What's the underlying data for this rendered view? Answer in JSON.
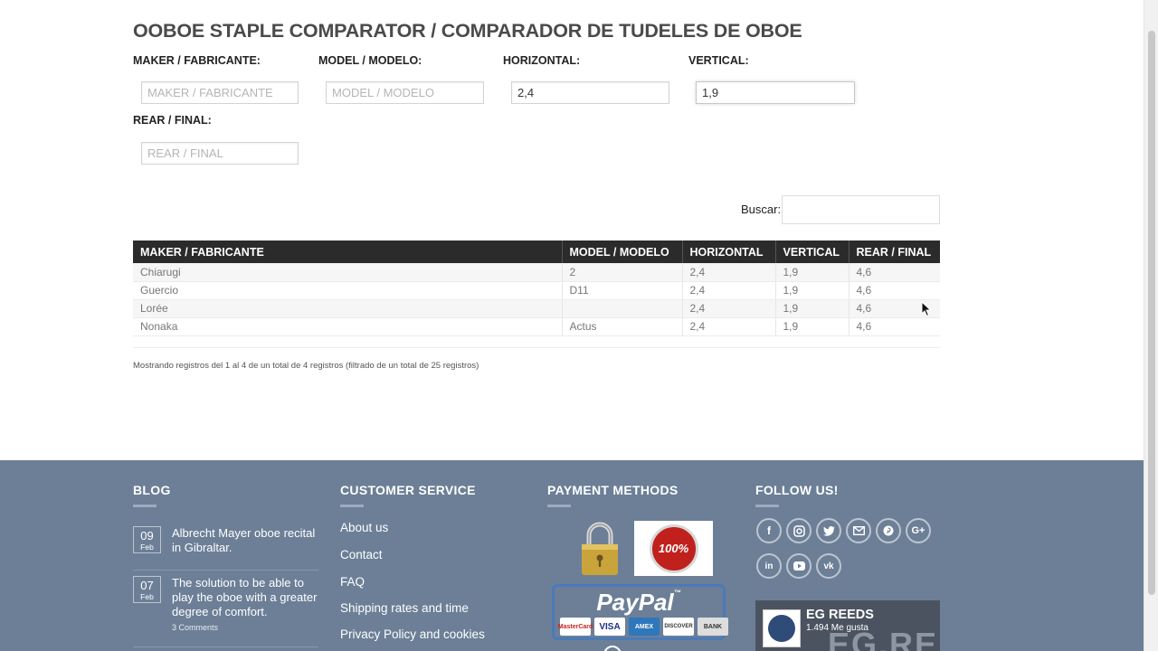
{
  "page_title": "OOBOE STAPLE COMPARATOR / COMPARADOR DE TUDELES DE OBOE",
  "filters": {
    "maker": {
      "label": "MAKER / FABRICANTE:",
      "placeholder": "MAKER / FABRICANTE",
      "value": ""
    },
    "model": {
      "label": "MODEL / MODELO:",
      "placeholder": "MODEL / MODELO",
      "value": ""
    },
    "horizontal": {
      "label": "HORIZONTAL:",
      "placeholder": "",
      "value": "2,4"
    },
    "vertical": {
      "label": "VERTICAL:",
      "placeholder": "",
      "value": "1,9"
    },
    "rear": {
      "label": "REAR / FINAL:",
      "placeholder": "REAR / FINAL",
      "value": ""
    }
  },
  "search": {
    "label": "Buscar:",
    "value": ""
  },
  "table": {
    "headers": [
      "MAKER / FABRICANTE",
      "MODEL / MODELO",
      "HORIZONTAL",
      "VERTICAL",
      "REAR / FINAL"
    ],
    "rows": [
      [
        "Chiarugi",
        "2",
        "2,4",
        "1,9",
        "4,6"
      ],
      [
        "Guercio",
        "D11",
        "2,4",
        "1,9",
        "4,6"
      ],
      [
        "Lorée",
        "",
        "2,4",
        "1,9",
        "4,6"
      ],
      [
        "Nonaka",
        "Actus",
        "2,4",
        "1,9",
        "4,6"
      ]
    ]
  },
  "info_text": "Mostrando registros del 1 al 4 de un total de 4 registros (filtrado de un total de 25 registros)",
  "footer": {
    "background": "#6c7f97",
    "blog": {
      "heading": "BLOG",
      "posts": [
        {
          "day": "09",
          "month": "Feb",
          "title": "Albrecht Mayer oboe recital in Gibraltar.",
          "comments": ""
        },
        {
          "day": "07",
          "month": "Feb",
          "title": "The solution to be able to play the oboe with a greater degree of comfort.",
          "comments": "3 Comments"
        }
      ]
    },
    "customer_service": {
      "heading": "CUSTOMER SERVICE",
      "links": [
        "About us",
        "Contact",
        "FAQ",
        "Shipping rates and time",
        "Privacy Policy and cookies"
      ]
    },
    "payment": {
      "heading": "PAYMENT METHODS",
      "seal_text": "100%",
      "paypal_text": "PayPal",
      "paypal_tm": "™",
      "cards": [
        "MasterCard",
        "VISA",
        "AMEX",
        "DISCOVER",
        "BANK"
      ]
    },
    "follow": {
      "heading": "FOLLOW US!",
      "icons": [
        "facebook-icon",
        "instagram-icon",
        "twitter-icon",
        "email-icon",
        "pinterest-icon",
        "google-plus-icon",
        "linkedin-icon",
        "youtube-icon",
        "vk-icon"
      ],
      "fb_name": "EG REEDS",
      "fb_likes": "1.494 Me gusta",
      "fb_bg_text": "EG.REE"
    }
  }
}
